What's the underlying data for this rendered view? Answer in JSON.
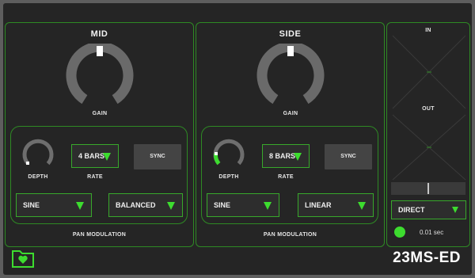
{
  "mid": {
    "title": "MID",
    "gain_label": "GAIN",
    "depth_label": "DEPTH",
    "rate_label": "RATE",
    "rate_value": "4 BARS",
    "sync_label": "SYNC",
    "shape_value": "SINE",
    "mode_value": "BALANCED",
    "section_label": "PAN MODULATION",
    "gain_level": 0.5,
    "depth_level": 0.0
  },
  "side": {
    "title": "SIDE",
    "gain_label": "GAIN",
    "depth_label": "DEPTH",
    "rate_label": "RATE",
    "rate_value": "8 BARS",
    "sync_label": "SYNC",
    "shape_value": "SINE",
    "mode_value": "LINEAR",
    "section_label": "PAN MODULATION",
    "gain_level": 0.5,
    "depth_level": 0.15
  },
  "scope": {
    "in_label": "IN",
    "out_label": "OUT",
    "mode_value": "DIRECT",
    "time_value": "0.01 sec"
  },
  "brand": "23MS-ED",
  "colors": {
    "accent": "#3ddc2f",
    "border": "#2e8a24",
    "background": "#252525",
    "knob_track": "#6a6a6a"
  },
  "icons": {
    "preset": "folder-heart-icon"
  }
}
